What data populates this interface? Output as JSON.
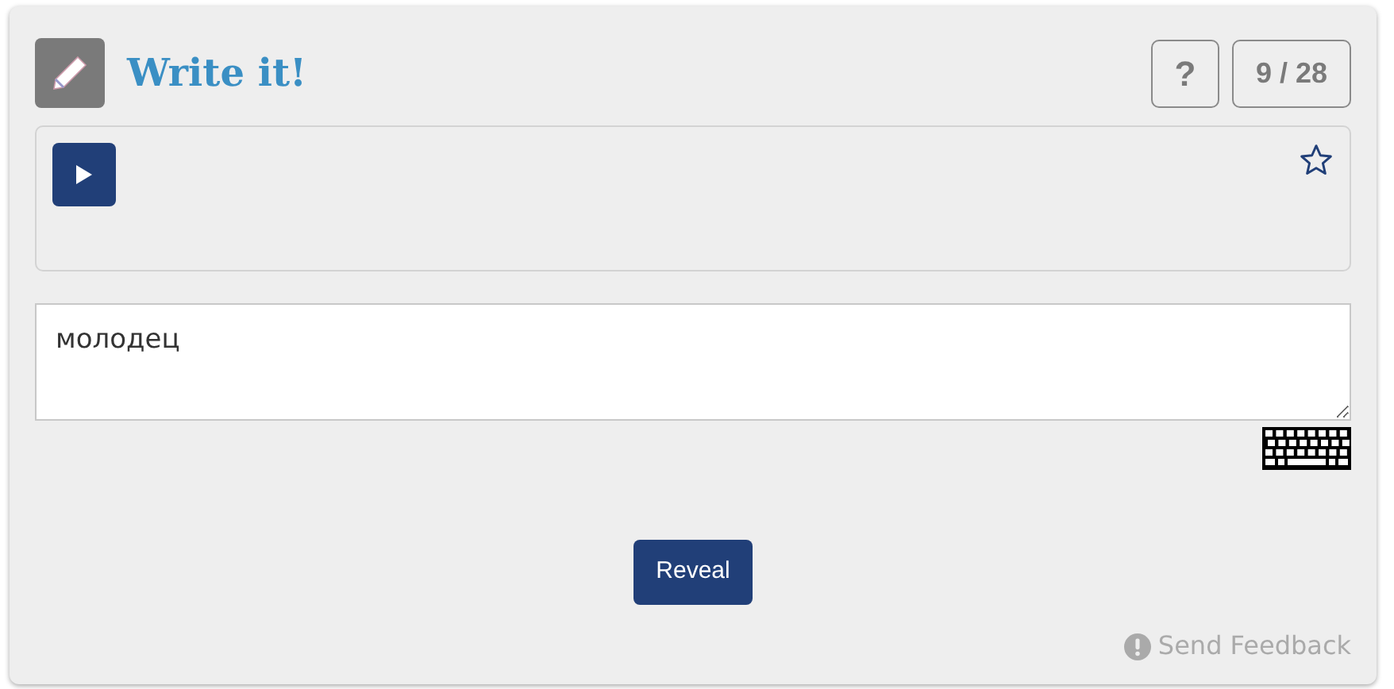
{
  "exercise": {
    "title": "Write it!",
    "help": "?",
    "counter": "9 / 28"
  },
  "audio_panel": {
    "starred": false
  },
  "answer": {
    "value": "молодец"
  },
  "reveal_button": "Reveal",
  "feedback_link": "Send Feedback"
}
